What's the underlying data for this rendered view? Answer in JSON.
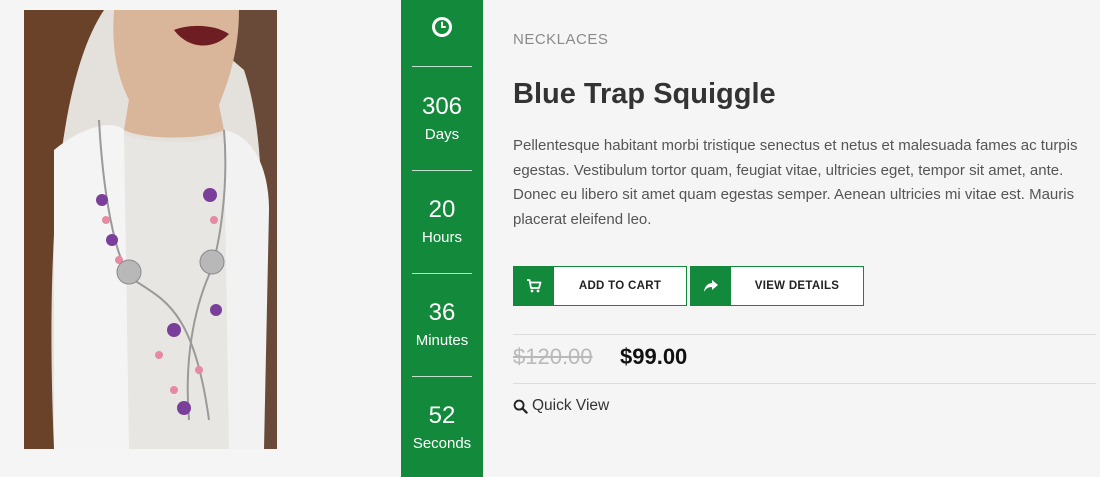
{
  "product": {
    "category": "NECKLACES",
    "title": "Blue Trap Squiggle",
    "description": "Pellentesque habitant morbi tristique senectus et netus et malesuada fames ac turpis egestas. Vestibulum tortor quam, feugiat vitae, ultricies eget, tempor sit amet, ante. Donec eu libero sit amet quam egestas semper. Aenean ultricies mi vitae est. Mauris placerat eleifend leo.",
    "old_price": "$120.00",
    "new_price": "$99.00"
  },
  "countdown": {
    "icon": "clock-icon",
    "days": {
      "value": "306",
      "label": "Days"
    },
    "hours": {
      "value": "20",
      "label": "Hours"
    },
    "minutes": {
      "value": "36",
      "label": "Minutes"
    },
    "seconds": {
      "value": "52",
      "label": "Seconds"
    }
  },
  "actions": {
    "add_to_cart": {
      "label": "ADD TO CART",
      "icon": "cart-icon"
    },
    "view_details": {
      "label": "VIEW DETAILS",
      "icon": "share-arrow-icon"
    },
    "quick_view": {
      "label": "Quick View",
      "icon": "search-icon"
    }
  },
  "colors": {
    "accent": "#138a3b",
    "old_price": "#b9b9b9"
  }
}
